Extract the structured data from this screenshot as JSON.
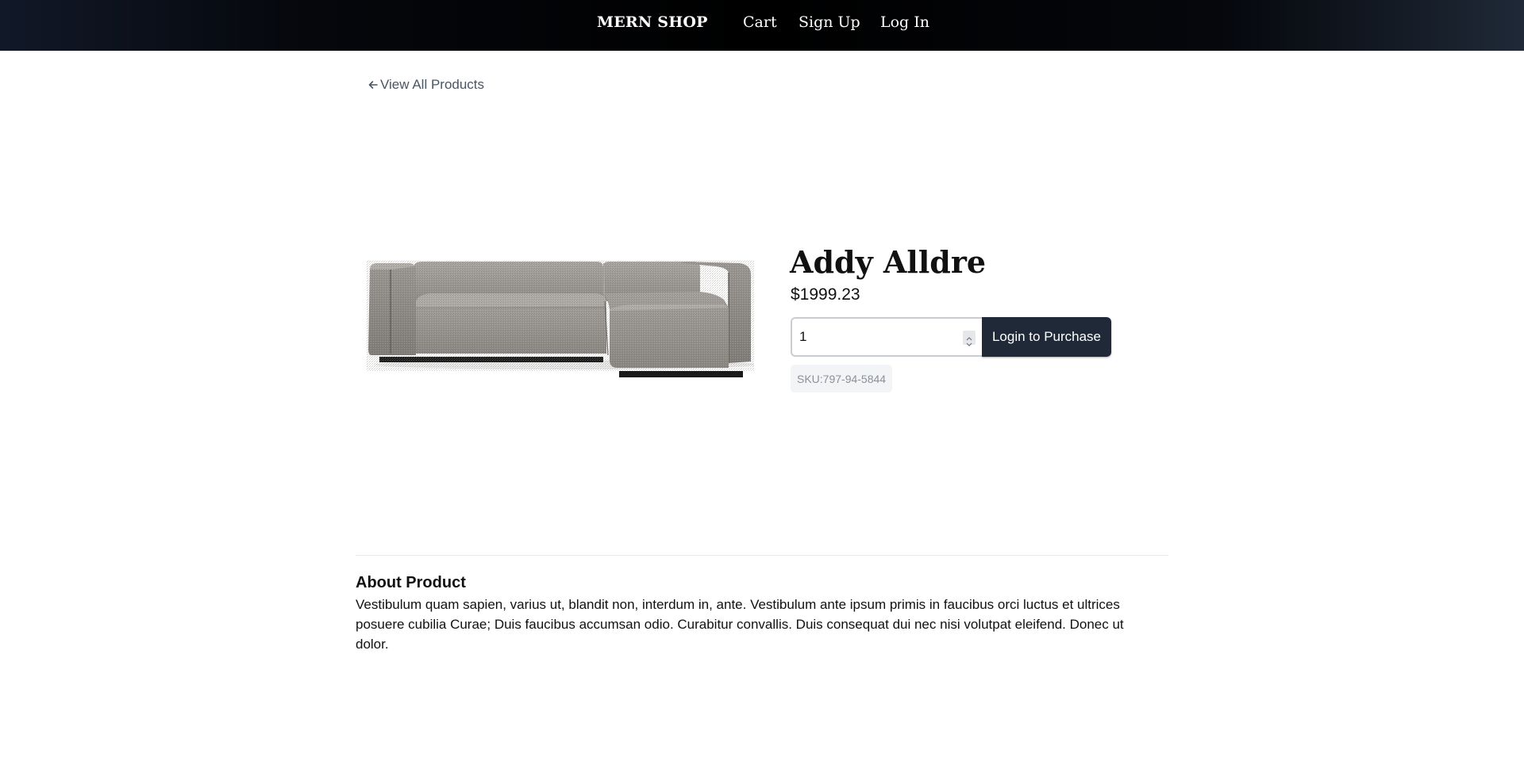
{
  "header": {
    "brand": "MERN SHOP",
    "nav": {
      "cart": "Cart",
      "sign_up": "Sign Up",
      "log_in": "Log In"
    }
  },
  "back_link": {
    "icon": "arrow-left-icon",
    "label": "View All Products"
  },
  "product": {
    "image_alt": "gray sectional sofa",
    "name": "Addy Alldre",
    "price": "$1999.23",
    "quantity": "1",
    "purchase_label": "Login to Purchase",
    "sku": "SKU:797-94-5844"
  },
  "about": {
    "title": "About Product",
    "description": "Vestibulum quam sapien, varius ut, blandit non, interdum in, ante. Vestibulum ante ipsum primis in faucibus orci luctus et ultrices posuere cubilia Curae; Duis faucibus accumsan odio. Curabitur convallis. Duis consequat dui nec nisi volutpat eleifend. Donec ut dolor."
  },
  "colors": {
    "header_bg": "#000000",
    "button_bg": "#1f2937",
    "sku_bg": "#f3f4f6"
  }
}
